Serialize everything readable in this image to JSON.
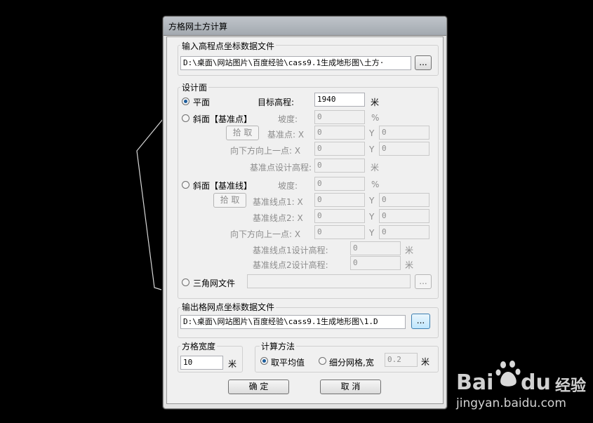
{
  "dialog_title": "方格网土方计算",
  "input_group": {
    "label": "输入高程点坐标数据文件",
    "path": "D:\\桌面\\网站图片\\百度经验\\cass9.1生成地形图\\土方·",
    "browse": "..."
  },
  "design_group": {
    "label": "设计面",
    "flat": {
      "label": "平面",
      "target_label": "目标高程:",
      "target_value": "1940",
      "unit": "米"
    },
    "slope_point": {
      "label": "斜面【基准点】",
      "grade_label": "坡度:",
      "grade_value": "0",
      "grade_unit": "%",
      "pick": "拾 取",
      "base_label": "基准点: X",
      "base_x": "0",
      "y": "Y",
      "base_y": "0",
      "dir_label": "向下方向上一点: X",
      "dir_x": "0",
      "dir_y": "0",
      "elev_label": "基准点设计高程:",
      "elev_value": "0",
      "elev_unit": "米"
    },
    "slope_line": {
      "label": "斜面【基准线】",
      "grade_label": "坡度:",
      "grade_value": "0",
      "grade_unit": "%",
      "pick": "拾 取",
      "p1_label": "基准线点1: X",
      "p1_x": "0",
      "y": "Y",
      "p1_y": "0",
      "p2_label": "基准线点2: X",
      "p2_x": "0",
      "p2_y": "0",
      "dir_label": "向下方向上一点: X",
      "dir_x": "0",
      "dir_y": "0",
      "e1_label": "基准线点1设计高程:",
      "e1_value": "0",
      "e2_label": "基准线点2设计高程:",
      "e2_value": "0",
      "unit": "米"
    },
    "tin": {
      "label": "三角网文件",
      "value": "",
      "browse": "..."
    }
  },
  "output_group": {
    "label": "输出格网点坐标数据文件",
    "path": "D:\\桌面\\网站图片\\百度经验\\cass9.1生成地形图\\1.D",
    "browse": "..."
  },
  "grid_width": {
    "label": "方格宽度",
    "value": "10",
    "unit": "米"
  },
  "calc_method": {
    "label": "计算方法",
    "avg": "取平均值",
    "subdivide": "细分网格,宽",
    "sub_value": "0.2",
    "unit": "米"
  },
  "buttons": {
    "ok": "确    定",
    "cancel": "取    消"
  },
  "watermark": {
    "brand_a": "Bai",
    "brand_b": "du",
    "brand_c": "经验",
    "url": "jingyan.baidu.com"
  },
  "colors": {
    "background": "#000000",
    "window_face": "#f0f0f0",
    "radio_dot": "#1d5d9b"
  }
}
